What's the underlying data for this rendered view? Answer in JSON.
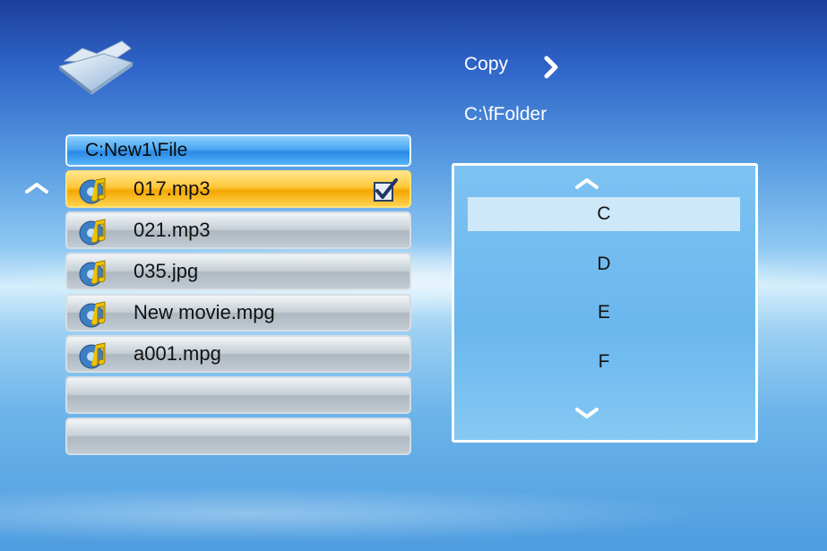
{
  "panel": {
    "path": "C:New1\\File",
    "files": [
      {
        "name": "017.mp3",
        "icon": "music-disc-icon",
        "selected": true,
        "checked": true
      },
      {
        "name": "021.mp3",
        "icon": "music-disc-icon",
        "selected": false,
        "checked": false
      },
      {
        "name": "035.jpg",
        "icon": "music-disc-icon",
        "selected": false,
        "checked": false
      },
      {
        "name": "New movie.mpg",
        "icon": "music-disc-icon",
        "selected": false,
        "checked": false
      },
      {
        "name": "a001.mpg",
        "icon": "music-disc-icon",
        "selected": false,
        "checked": false
      },
      {
        "name": "",
        "icon": "",
        "selected": false,
        "checked": false
      },
      {
        "name": "",
        "icon": "",
        "selected": false,
        "checked": false
      }
    ]
  },
  "action": {
    "label": "Copy",
    "icon": "chevron-right-icon"
  },
  "destination": {
    "path": "C:\\fFolder"
  },
  "drives": {
    "items": [
      "C",
      "D",
      "E",
      "F"
    ],
    "highlighted": 0
  },
  "colors": {
    "selected_row": "#ffc638",
    "path_bar": "#4aa8f2",
    "drive_panel": "#6ab7ee",
    "drive_highlight": "#cde8f8"
  }
}
